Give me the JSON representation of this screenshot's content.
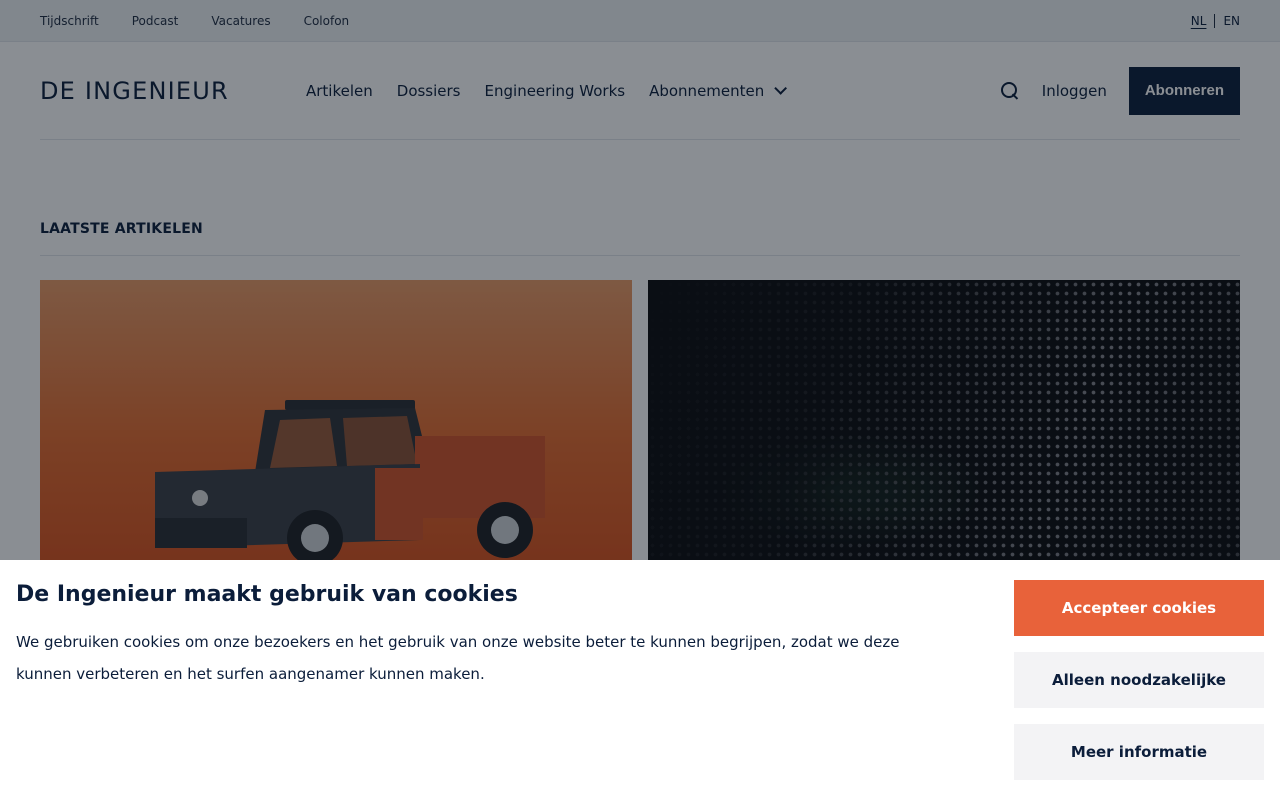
{
  "topbar": {
    "links": [
      "Tijdschrift",
      "Podcast",
      "Vacatures",
      "Colofon"
    ],
    "lang_active": "NL",
    "lang_other": "EN"
  },
  "header": {
    "logo": "DE INGENIEUR",
    "nav": [
      "Artikelen",
      "Dossiers",
      "Engineering Works",
      "Abonnementen"
    ],
    "login": "Inloggen",
    "subscribe": "Abonneren"
  },
  "main": {
    "section_title": "LAATSTE ARTIKELEN"
  },
  "cookie": {
    "title": "De Ingenieur maakt gebruik van cookies",
    "text": "We gebruiken cookies om onze bezoekers en het gebruik van onze website beter te kunnen begrijpen, zodat we deze kunnen verbeteren en het surfen aangenamer kunnen maken.",
    "accept": "Accepteer cookies",
    "necessary": "Alleen noodzakelijke",
    "more": "Meer informatie"
  },
  "colors": {
    "navy": "#0b1d3a",
    "accent": "#e8623a"
  }
}
